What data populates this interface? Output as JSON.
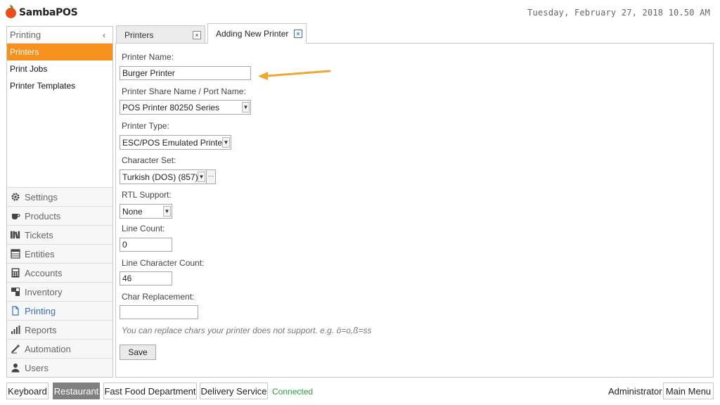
{
  "app": {
    "name": "SambaPOS"
  },
  "datetime": "Tuesday, February 27, 2018 10.50 AM",
  "sidebar": {
    "section_title": "Printing",
    "collapse_glyph": "‹",
    "items": [
      {
        "label": "Printers",
        "active": true
      },
      {
        "label": "Print Jobs",
        "active": false
      },
      {
        "label": "Printer Templates",
        "active": false
      }
    ]
  },
  "modules": [
    {
      "label": "Settings",
      "icon": "gear-icon"
    },
    {
      "label": "Products",
      "icon": "coffee-cup-icon"
    },
    {
      "label": "Tickets",
      "icon": "tickets-icon"
    },
    {
      "label": "Entities",
      "icon": "entities-icon"
    },
    {
      "label": "Accounts",
      "icon": "calculator-icon"
    },
    {
      "label": "Inventory",
      "icon": "inventory-icon"
    },
    {
      "label": "Printing",
      "icon": "document-icon",
      "active": true
    },
    {
      "label": "Reports",
      "icon": "bar-chart-icon"
    },
    {
      "label": "Automation",
      "icon": "wand-icon"
    },
    {
      "label": "Users",
      "icon": "user-icon"
    }
  ],
  "tabs": [
    {
      "label": "Printers",
      "active": false,
      "close": "×"
    },
    {
      "label": "Adding New Printer",
      "active": true,
      "close": "×"
    }
  ],
  "form": {
    "printer_name": {
      "label": "Printer Name:",
      "value": "Burger Printer"
    },
    "share_name": {
      "label": "Printer Share Name / Port Name:",
      "value": "POS Printer 80250 Series"
    },
    "printer_type": {
      "label": "Printer Type:",
      "value": "ESC/POS Emulated Printer"
    },
    "character_set": {
      "label": "Character Set:",
      "value": "Turkish (DOS) (857)",
      "more": "···"
    },
    "rtl_support": {
      "label": "RTL Support:",
      "value": "None"
    },
    "line_count": {
      "label": "Line Count:",
      "value": "0"
    },
    "line_char_count": {
      "label": "Line Character Count:",
      "value": "46"
    },
    "char_replacement": {
      "label": "Char Replacement:",
      "value": ""
    },
    "hint": "You can replace chars your printer does not support. e.g. ö=o,ß=ss",
    "save_label": "Save",
    "dropdown_glyph": "▼"
  },
  "annotation": {
    "arrow_color": "#f0a830"
  },
  "footer": {
    "buttons": [
      {
        "label": "Keyboard",
        "active": false
      },
      {
        "label": "Restaurant",
        "active": true
      },
      {
        "label": "Fast Food Department",
        "active": false
      },
      {
        "label": "Delivery Service",
        "active": false
      }
    ],
    "status": "Connected",
    "user": "Administrator",
    "main_menu": "Main Menu"
  },
  "colors": {
    "accent": "#f6901e",
    "active_module": "#3a6fb3",
    "connected": "#2e9b37",
    "footer_active": "#808080"
  }
}
